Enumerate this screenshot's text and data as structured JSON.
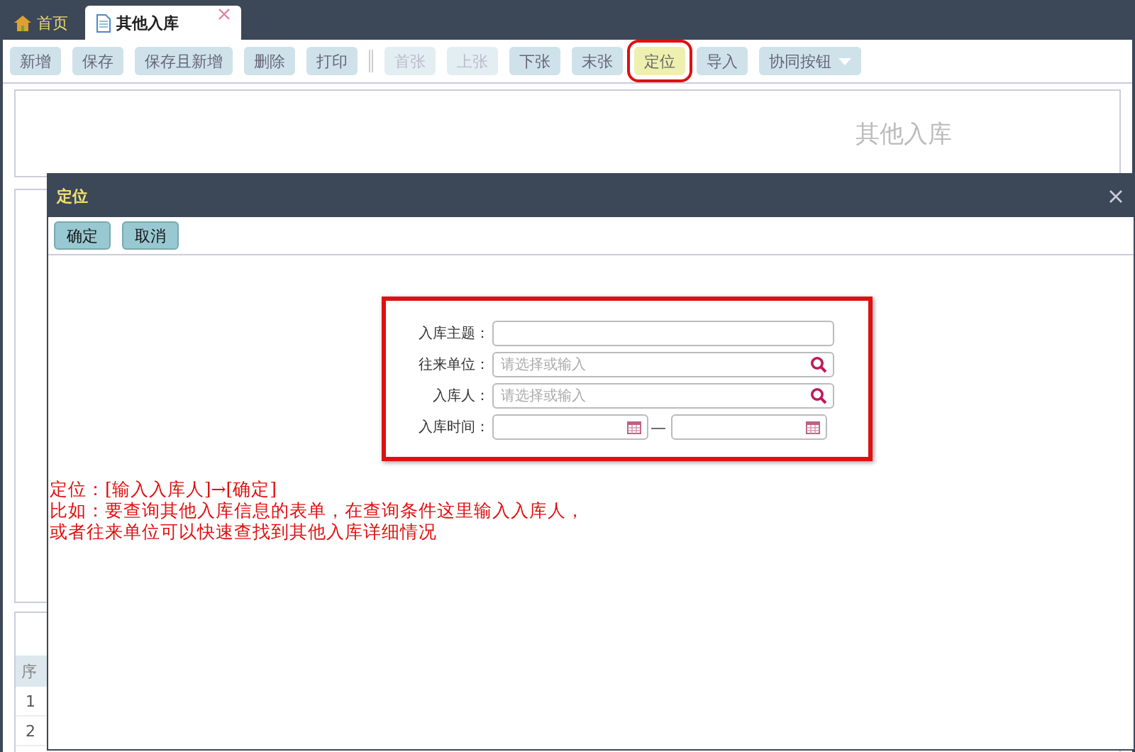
{
  "tabs": [
    {
      "label": "首页",
      "kind": "home",
      "selected": false,
      "closable": false
    },
    {
      "label": "其他入库",
      "kind": "doc",
      "selected": true,
      "closable": true
    }
  ],
  "toolbar": [
    {
      "label": "新增",
      "kind": "button",
      "disabled": false,
      "highlighted": false
    },
    {
      "label": "保存",
      "kind": "button",
      "disabled": false,
      "highlighted": false
    },
    {
      "label": "保存且新增",
      "kind": "button",
      "disabled": false,
      "highlighted": false
    },
    {
      "label": "删除",
      "kind": "button",
      "disabled": false,
      "highlighted": false
    },
    {
      "label": "打印",
      "kind": "button",
      "disabled": false,
      "highlighted": false
    },
    {
      "kind": "separator"
    },
    {
      "label": "首张",
      "kind": "button",
      "disabled": true,
      "highlighted": false
    },
    {
      "label": "上张",
      "kind": "button",
      "disabled": true,
      "highlighted": false
    },
    {
      "label": "下张",
      "kind": "button",
      "disabled": false,
      "highlighted": false
    },
    {
      "label": "末张",
      "kind": "button",
      "disabled": false,
      "highlighted": false
    },
    {
      "label": "定位",
      "kind": "button",
      "disabled": false,
      "highlighted": true
    },
    {
      "label": "导入",
      "kind": "button",
      "disabled": false,
      "highlighted": false
    },
    {
      "label": "协同按钮",
      "kind": "dropdown",
      "disabled": false,
      "highlighted": false
    }
  ],
  "form_title": "其他入库",
  "table": {
    "column_1": "序",
    "rows": [
      "1",
      "2"
    ]
  },
  "dialog": {
    "title": "定位",
    "buttons": [
      "确定",
      "取消"
    ],
    "fields": [
      {
        "label": "入库主题：",
        "kind": "text"
      },
      {
        "label": "往来单位：",
        "kind": "search",
        "placeholder": "请选择或输入"
      },
      {
        "label": "入库人：",
        "kind": "search",
        "placeholder": "请选择或输入"
      },
      {
        "label": "入库时间：",
        "kind": "daterange",
        "separator": "—"
      }
    ]
  },
  "annotation": [
    "定位：[输入入库人]→[确定]",
    "比如：要查询其他入库信息的表单，在查询条件这里输入入库人，",
    "或者往来单位可以快速查找到其他入库详细情况"
  ]
}
